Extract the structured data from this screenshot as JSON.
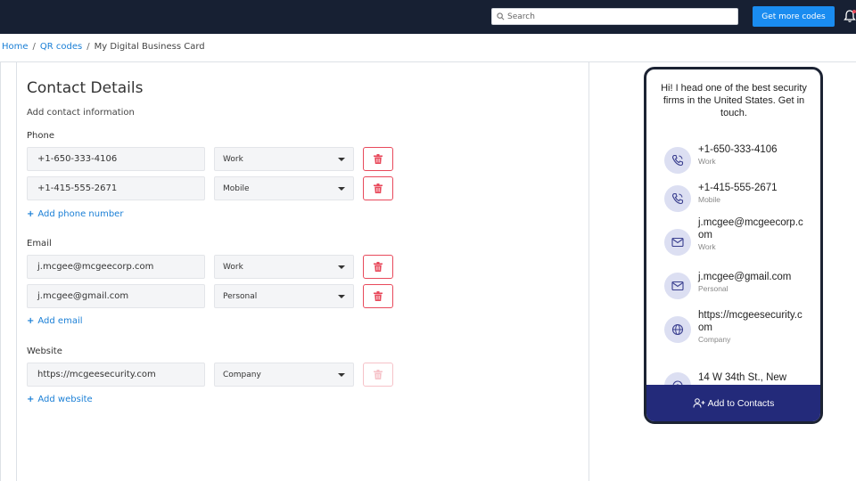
{
  "topbar": {
    "search_placeholder": "Search",
    "get_more_label": "Get more codes"
  },
  "breadcrumb": {
    "home": "Home",
    "qr_codes": "QR codes",
    "current": "My Digital Business Card",
    "separator": "/"
  },
  "form": {
    "title": "Contact Details",
    "subtitle": "Add contact information",
    "phone": {
      "label": "Phone",
      "rows": [
        {
          "value": "+1-650-333-4106",
          "type": "Work"
        },
        {
          "value": "+1-415-555-2671",
          "type": "Mobile"
        }
      ],
      "add_label": "Add phone number"
    },
    "email": {
      "label": "Email",
      "rows": [
        {
          "value": "j.mcgee@mcgeecorp.com",
          "type": "Work"
        },
        {
          "value": "j.mcgee@gmail.com",
          "type": "Personal"
        }
      ],
      "add_label": "Add email"
    },
    "website": {
      "label": "Website",
      "rows": [
        {
          "value": "https://mcgeesecurity.com",
          "type": "Company"
        }
      ],
      "add_label": "Add website"
    },
    "add_symbol": "+"
  },
  "preview": {
    "bio": "Hi! I head one of the best security firms in the United States. Get in touch.",
    "contacts": [
      {
        "icon": "phone-icon",
        "value": "+1-650-333-4106",
        "type": "Work"
      },
      {
        "icon": "phone-icon",
        "value": "+1-415-555-2671",
        "type": "Mobile"
      },
      {
        "icon": "mail-icon",
        "value": "j.mcgee@mcgeecorp.com",
        "type": "Work"
      },
      {
        "icon": "mail-icon",
        "value": "j.mcgee@gmail.com",
        "type": "Personal"
      },
      {
        "icon": "globe-icon",
        "value": "https://mcgeesecurity.com",
        "type": "Company"
      },
      {
        "icon": "location-icon",
        "value": "14 W 34th St., New",
        "type": ""
      }
    ],
    "add_to_contacts": "Add to Contacts"
  },
  "colors": {
    "topbar": "#172033",
    "primary_button": "#1a8cf0",
    "link": "#1a7fd6",
    "delete": "#e8495b",
    "preview_bar": "#232a7a",
    "icon_circle": "#dcdff2"
  }
}
